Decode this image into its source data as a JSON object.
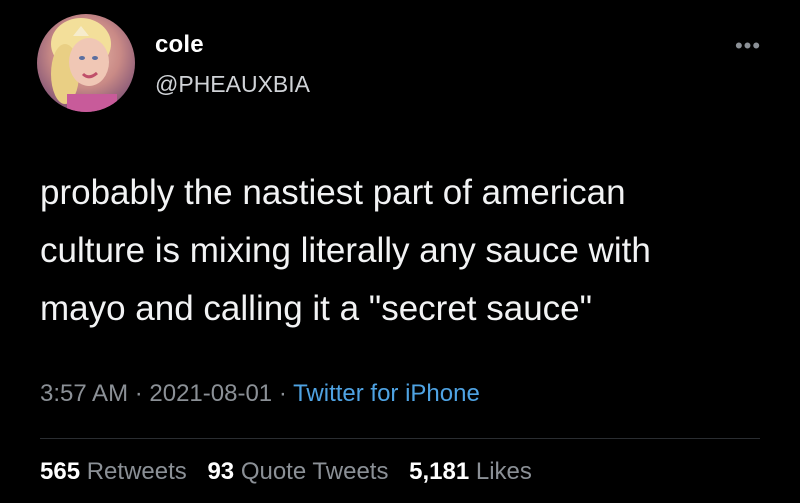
{
  "user": {
    "display_name": "cole",
    "handle": "@PHEAUXBIA"
  },
  "more_icon": "•••",
  "tweet": {
    "lines": [
      "probably the nastiest part of american",
      "culture is mixing literally any sauce with",
      "mayo and calling it a \"secret sauce\""
    ]
  },
  "meta": {
    "time": "3:57 AM",
    "sep1": " · ",
    "date": "2021-08-01",
    "sep2": " · ",
    "source": "Twitter for iPhone"
  },
  "stats": {
    "retweets_count": "565",
    "retweets_label": "Retweets",
    "quotes_count": "93",
    "quotes_label": "Quote Tweets",
    "likes_count": "5,181",
    "likes_label": "Likes"
  },
  "colors": {
    "background": "#000000",
    "text": "#f2f3f4",
    "muted": "#8b9096",
    "link": "#4fa3e3",
    "divider": "#2a2d31"
  }
}
